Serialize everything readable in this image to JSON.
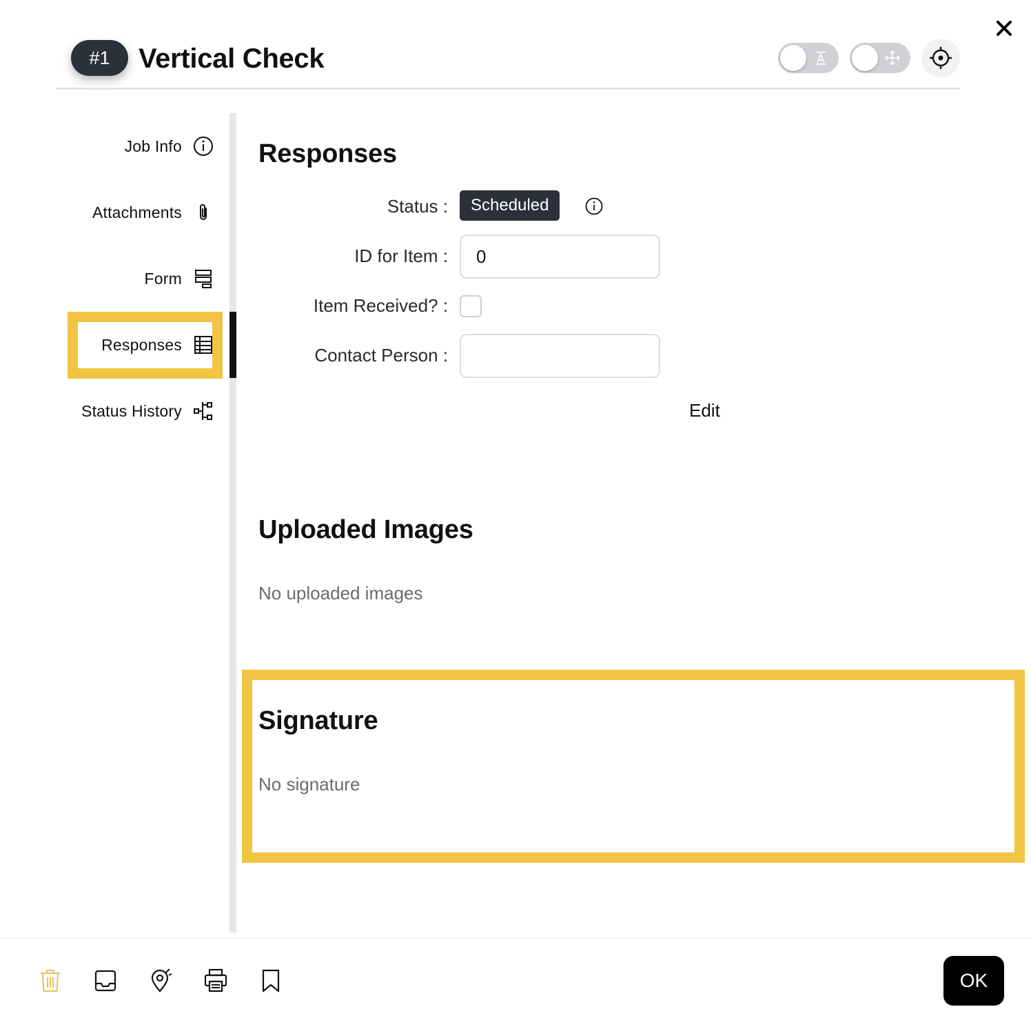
{
  "header": {
    "job_number": "#1",
    "title": "Vertical Check",
    "toggle_text_icon": "text-format-icon",
    "toggle_move_icon": "move-arrows-icon",
    "target_icon": "crosshair-icon",
    "close_icon": "close-icon"
  },
  "sidebar": {
    "items": [
      {
        "label": "Job Info",
        "icon": "info-icon"
      },
      {
        "label": "Attachments",
        "icon": "paperclip-icon"
      },
      {
        "label": "Form",
        "icon": "form-icon"
      },
      {
        "label": "Responses",
        "icon": "table-icon",
        "active": true
      },
      {
        "label": "Status History",
        "icon": "hierarchy-icon"
      }
    ]
  },
  "responses": {
    "title": "Responses",
    "status_label": "Status",
    "status_value": "Scheduled",
    "id_label": "ID for Item",
    "id_value": "0",
    "received_label": "Item Received?",
    "received_checked": false,
    "contact_label": "Contact Person",
    "contact_value": "",
    "edit_label": "Edit"
  },
  "images": {
    "title": "Uploaded Images",
    "empty": "No uploaded images"
  },
  "signature": {
    "title": "Signature",
    "empty": "No signature"
  },
  "footer": {
    "icons": [
      "trash-icon",
      "inbox-icon",
      "map-pin-icon",
      "printer-icon",
      "bookmark-icon"
    ],
    "ok_label": "OK"
  },
  "colors": {
    "highlight": "#f2c444",
    "dark": "#2b3139",
    "trash": "#e8c35a"
  }
}
